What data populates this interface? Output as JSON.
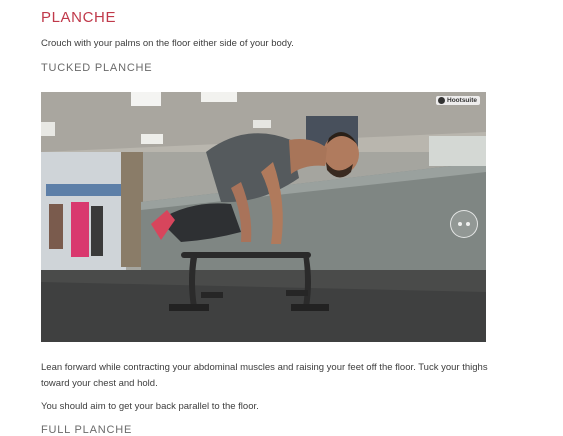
{
  "article": {
    "title": "PLANCHE",
    "intro": "Crouch with your palms on the floor either side of your body.",
    "section_1": {
      "heading": "TUCKED PLANCHE",
      "photo": {
        "subject": "man in tucked planche on parallette bars in a gym",
        "watermark": "Hootsuite"
      },
      "step_text": "Lean forward while contracting your abdominal muscles and raising your feet off the floor. Tuck your thighs toward your chest and hold.",
      "tip_text": "You should aim to get your back parallel to the floor."
    },
    "section_2": {
      "heading": "FULL PLANCHE"
    }
  },
  "colors": {
    "title": "#c0394a",
    "subheading": "#6a6a6a",
    "body": "#3d3d3d"
  }
}
